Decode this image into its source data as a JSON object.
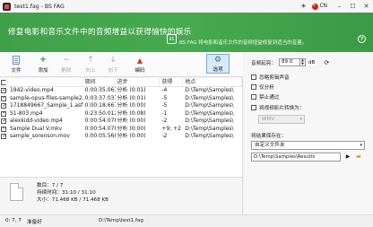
{
  "window": {
    "title": "test1.fag - BS FAG",
    "language": "CN"
  },
  "banner": {
    "headline": "修复电影和音乐文件中的音频增益以获得愉快的娱乐",
    "logo_text": "BS",
    "description": "BS FAG 将电影和音乐文件的音频增益修复到适当的音量。",
    "help": "?"
  },
  "toolbar": {
    "file": "文件",
    "add": "添加",
    "delete": "删除",
    "up": "向上",
    "down": "向下",
    "encode": "编码",
    "options": "选项"
  },
  "table": {
    "headers": [
      "期间",
      "进步",
      "获得",
      "地点"
    ],
    "rows": [
      {
        "name": "1942-video.mp4",
        "duration": "0:00:35.063",
        "progress": "分析 (0:01)",
        "gain": "-4",
        "path": "D:\\Temp\\Samples\\"
      },
      {
        "name": "sample-opus-files-sample2.opus",
        "duration": "0:03:37.037",
        "progress": "分析 (0:01)",
        "gain": "-5",
        "path": "D:\\Temp\\Samples\\"
      },
      {
        "name": "1718849667_Sample_1.asf",
        "duration": "0:00:18.667",
        "progress": "分析 (0:00)",
        "gain": "-5",
        "path": "D:\\Temp\\Samples\\"
      },
      {
        "name": "S1-803.mp4",
        "duration": "0:23:50.012",
        "progress": "分析 (0:08)",
        "gain": "-1",
        "path": "D:\\Temp\\Samples\\"
      },
      {
        "name": "alexkidd-video.mp4",
        "duration": "0:00:54.078",
        "progress": "分析 (0:00)",
        "gain": "-2",
        "path": "D:\\Temp\\Samples\\"
      },
      {
        "name": "Sample Dual V.mkv",
        "duration": "0:00:54.078",
        "progress": "分析 (0:00)",
        "gain": "+9; +2",
        "path": "D:\\Temp\\Samples\\"
      },
      {
        "name": "sample_sorenson.mov",
        "duration": "0:00:05.568",
        "progress": "分析 (0:00)",
        "gain": "-2",
        "path": "D:\\Temp\\Samples\\"
      }
    ]
  },
  "summary": {
    "files": "数目：7 / 7",
    "duration": "持续时间：31:10 / 31:10",
    "size": "大小：71.468 KB / 71.468 KB"
  },
  "statusbar": {
    "counter": "0: 7, 7",
    "state": "准备好",
    "path": "D:\\Temp\\test1.fag"
  },
  "options": {
    "gain_label": "音频起亮：",
    "gain_value": "89.0",
    "gain_unit": "dB",
    "ignore_clipping": "忽略剪辑声音",
    "analyze_only": "仅分析",
    "no_recompression": "禁止通过",
    "convert_video": "将视频影片转换为：",
    "video_format": "WMV",
    "save_to_label": "将结果保存在：",
    "save_to_option": "自定义文件夹",
    "save_path": "D:\\Temp\\Samples\\Results"
  }
}
